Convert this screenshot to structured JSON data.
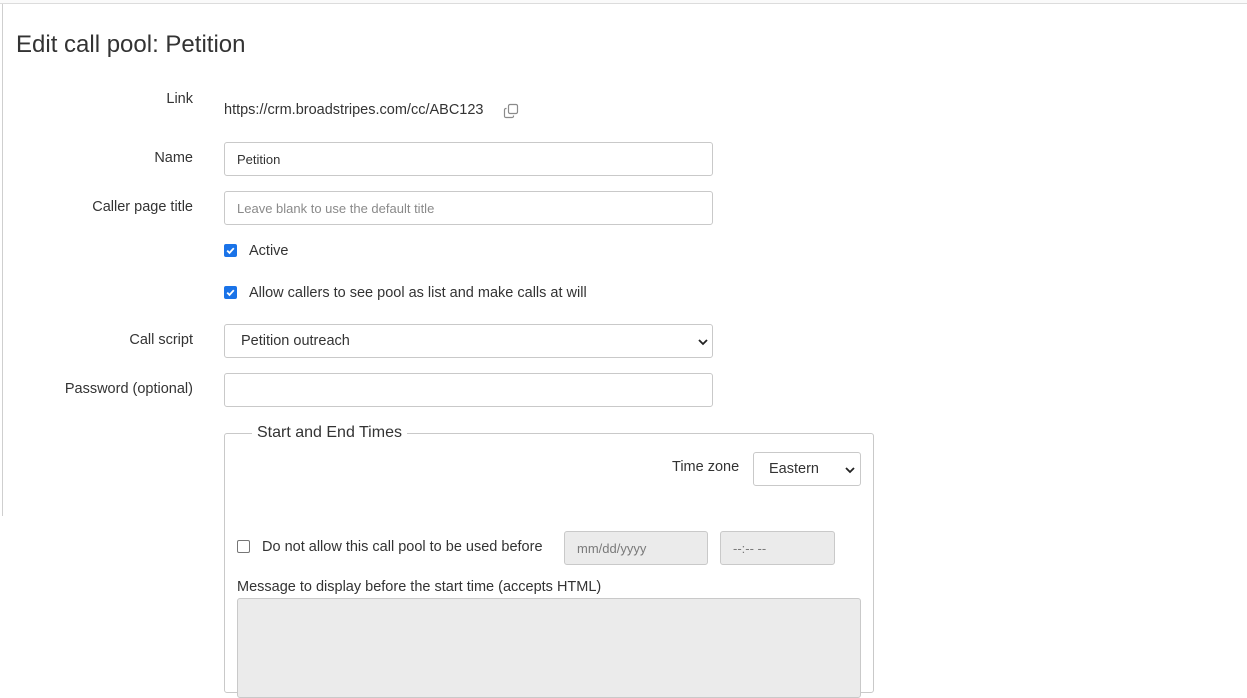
{
  "page": {
    "title": "Edit call pool: Petition"
  },
  "form": {
    "link": {
      "label": "Link",
      "value": "https://crm.broadstripes.com/cc/ABC123"
    },
    "name": {
      "label": "Name",
      "value": "Petition"
    },
    "caller_page_title": {
      "label": "Caller page title",
      "placeholder": "Leave blank to use the default title"
    },
    "active": {
      "label": "Active",
      "checked": true
    },
    "allow_list": {
      "label": "Allow callers to see pool as list and make calls at will",
      "checked": true
    },
    "call_script": {
      "label": "Call script",
      "selected": "Petition outreach"
    },
    "password": {
      "label": "Password (optional)",
      "value": ""
    }
  },
  "times": {
    "legend": "Start and End Times",
    "timezone_label": "Time zone",
    "timezone_selected": "Eastern",
    "not_before": {
      "label": "Do not allow this call pool to be used before",
      "checked": false,
      "date_placeholder": "mm/dd/yyyy",
      "time_placeholder": "--:-- --"
    },
    "message_label": "Message to display before the start time (accepts HTML)"
  },
  "colors": {
    "checkbox_accent": "#1a73e8",
    "disabled_bg": "#ebebeb",
    "border": "#c9c9c9"
  }
}
